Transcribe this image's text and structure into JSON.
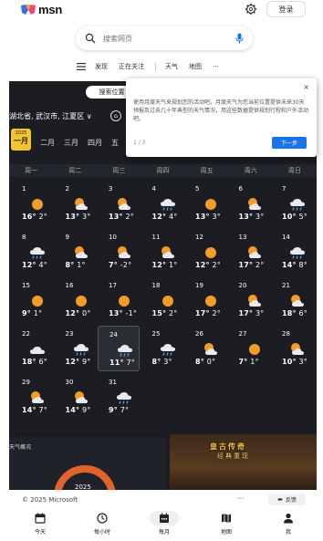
{
  "header": {
    "logo_text": "msn",
    "login_label": "登录"
  },
  "search": {
    "placeholder": "搜索网页"
  },
  "nav": {
    "items": [
      "发现",
      "正在关注",
      "天气",
      "地图",
      "···"
    ]
  },
  "calendar": {
    "location_button": "搜索位置",
    "location": "湖北省, 武汉市, 江夏区",
    "location_caret": "∨",
    "year_badge_year": "2025",
    "year_badge_month": "一月",
    "months": [
      "二月",
      "三月",
      "四月",
      "五"
    ],
    "weekdays": [
      "周一",
      "周二",
      "周三",
      "周四",
      "周五",
      "周六",
      "周日"
    ],
    "days": [
      {
        "d": "1",
        "hi": "16°",
        "lo": "2°",
        "icon": "sun"
      },
      {
        "d": "2",
        "hi": "13°",
        "lo": "3°",
        "icon": "sun-cloud"
      },
      {
        "d": "3",
        "hi": "13°",
        "lo": "2°",
        "icon": "sun-cloud"
      },
      {
        "d": "4",
        "hi": "12°",
        "lo": "4°",
        "icon": "cloud-rain"
      },
      {
        "d": "5",
        "hi": "13°",
        "lo": "3°",
        "icon": "sun"
      },
      {
        "d": "6",
        "hi": "13°",
        "lo": "3°",
        "icon": "sun-cloud"
      },
      {
        "d": "7",
        "hi": "10°",
        "lo": "5°",
        "icon": "cloud-rain"
      },
      {
        "d": "8",
        "hi": "12°",
        "lo": "4°",
        "icon": "cloud-rain"
      },
      {
        "d": "9",
        "hi": "8°",
        "lo": "1°",
        "icon": "sun-cloud"
      },
      {
        "d": "10",
        "hi": "7°",
        "lo": "-2°",
        "icon": "sun-cloud"
      },
      {
        "d": "11",
        "hi": "12°",
        "lo": "1°",
        "icon": "sun-cloud"
      },
      {
        "d": "12",
        "hi": "12°",
        "lo": "2°",
        "icon": "sun"
      },
      {
        "d": "13",
        "hi": "17°",
        "lo": "2°",
        "icon": "sun-cloud"
      },
      {
        "d": "14",
        "hi": "14°",
        "lo": "8°",
        "icon": "cloud-rain"
      },
      {
        "d": "15",
        "hi": "9°",
        "lo": "1°",
        "icon": "sun"
      },
      {
        "d": "16",
        "hi": "12°",
        "lo": "0°",
        "icon": "sun"
      },
      {
        "d": "17",
        "hi": "13°",
        "lo": "-1°",
        "icon": "sun"
      },
      {
        "d": "18",
        "hi": "15°",
        "lo": "2°",
        "icon": "sun"
      },
      {
        "d": "19",
        "hi": "17°",
        "lo": "2°",
        "icon": "sun"
      },
      {
        "d": "20",
        "hi": "17°",
        "lo": "3°",
        "icon": "sun-cloud"
      },
      {
        "d": "21",
        "hi": "18°",
        "lo": "6°",
        "icon": "sun-cloud"
      },
      {
        "d": "22",
        "hi": "18°",
        "lo": "6°",
        "icon": "cloud"
      },
      {
        "d": "23",
        "hi": "12°",
        "lo": "9°",
        "icon": "cloud-rain"
      },
      {
        "d": "24",
        "hi": "11°",
        "lo": "7°",
        "icon": "cloud-rain",
        "today": true
      },
      {
        "d": "25",
        "hi": "8°",
        "lo": "3°",
        "icon": "cloud-rain"
      },
      {
        "d": "26",
        "hi": "8°",
        "lo": "0°",
        "icon": "sun-cloud"
      },
      {
        "d": "27",
        "hi": "7°",
        "lo": "1°",
        "icon": "sun"
      },
      {
        "d": "28",
        "hi": "10°",
        "lo": "3°",
        "icon": "sun-cloud"
      },
      {
        "d": "29",
        "hi": "14°",
        "lo": "7°",
        "icon": "sun-cloud"
      },
      {
        "d": "30",
        "hi": "14°",
        "lo": "9°",
        "icon": "sun-cloud"
      },
      {
        "d": "31",
        "hi": "9°",
        "lo": "7°",
        "icon": "cloud-rain"
      }
    ],
    "section_title": "天气概况",
    "donut_year": "2025"
  },
  "ad": {
    "title": "皇古传奇",
    "subtitle": "经典重现"
  },
  "popup": {
    "close": "×",
    "text": "使用月度天气来规划您的活动吧。月度天气为您当前位置提供未来30天预报及过去几十年典型的天气情况，用这些数据提供规划行程和户外活动吧。",
    "pager": "1 / 3",
    "next": "下一步"
  },
  "footer": {
    "copyright": "© 2025 Microsoft",
    "dots": "···",
    "feedback": "反馈"
  },
  "tabbar": {
    "tabs": [
      {
        "label": "今天",
        "icon": "calendar-today-icon"
      },
      {
        "label": "每小时",
        "icon": "clock-icon"
      },
      {
        "label": "每月",
        "icon": "calendar-month-icon",
        "active": true
      },
      {
        "label": "地图",
        "icon": "map-icon"
      },
      {
        "label": "我",
        "icon": "person-icon"
      }
    ]
  },
  "colors": {
    "dark_bg": "#1b1d22",
    "accent": "#1a73e8",
    "badge": "#f4c430",
    "sun": "#f59b2a"
  }
}
